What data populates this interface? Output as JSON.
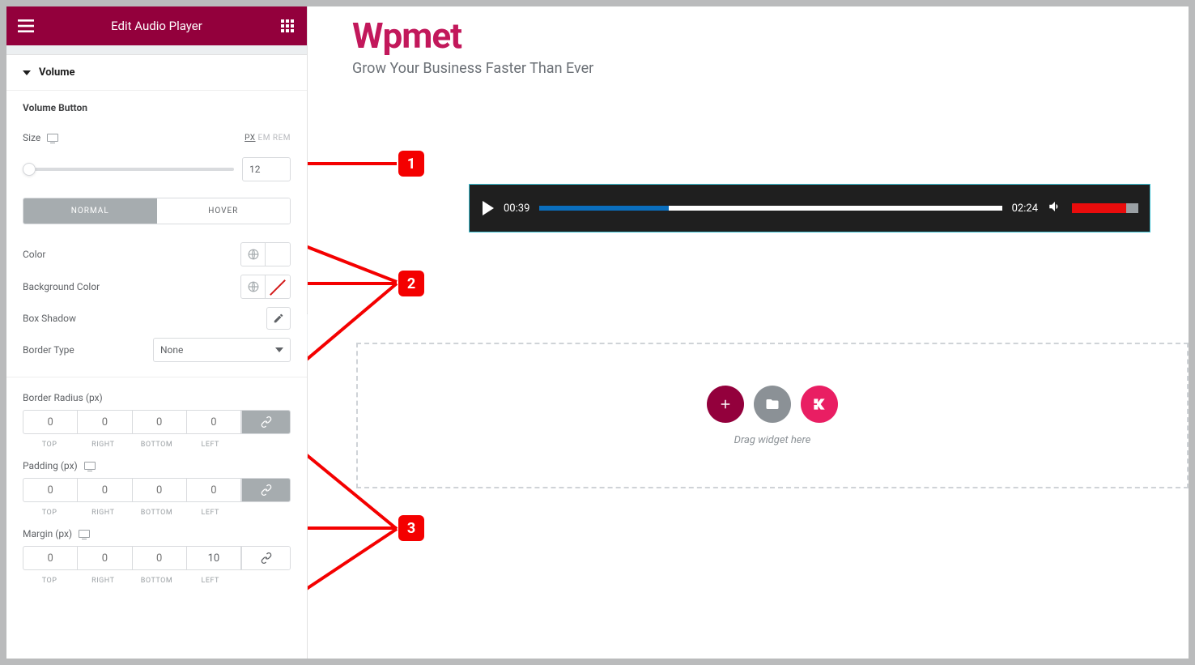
{
  "header": {
    "title": "Edit Audio Player"
  },
  "section": {
    "title": "Volume",
    "subtitle": "Volume Button"
  },
  "size": {
    "label": "Size",
    "value": "12",
    "units": {
      "px": "PX",
      "em": "EM",
      "rem": "REM"
    }
  },
  "state_tabs": {
    "normal": "NORMAL",
    "hover": "HOVER"
  },
  "controls": {
    "color_label": "Color",
    "bg_label": "Background Color",
    "shadow_label": "Box Shadow",
    "border_type_label": "Border Type",
    "border_type_value": "None"
  },
  "dims": {
    "radius": {
      "label": "Border Radius (px)",
      "top": "0",
      "right": "0",
      "bottom": "0",
      "left": "0",
      "linked": true
    },
    "padding": {
      "label": "Padding (px)",
      "top": "0",
      "right": "0",
      "bottom": "0",
      "left": "0",
      "linked": true
    },
    "margin": {
      "label": "Margin (px)",
      "top": "0",
      "right": "0",
      "bottom": "0",
      "left": "10",
      "linked": false
    },
    "sublabels": {
      "top": "TOP",
      "right": "RIGHT",
      "bottom": "BOTTOM",
      "left": "LEFT"
    }
  },
  "page": {
    "brand": "Wpmet",
    "tagline": "Grow Your Business Faster Than Ever"
  },
  "audio": {
    "current": "00:39",
    "total": "02:24",
    "progress_pct": 28,
    "volume_pct": 82
  },
  "dropzone": {
    "hint": "Drag widget here"
  },
  "markers": {
    "m1": "1",
    "m2": "2",
    "m3": "3"
  }
}
